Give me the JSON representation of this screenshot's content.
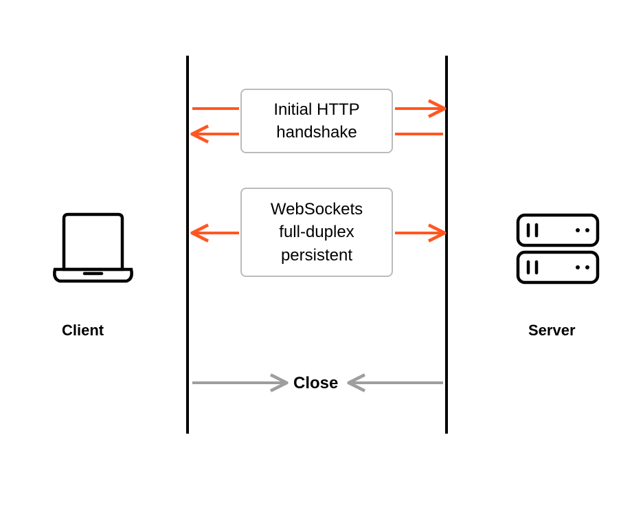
{
  "diagram_type": "sequence",
  "client": {
    "label": "Client"
  },
  "server": {
    "label": "Server"
  },
  "steps": {
    "handshake": {
      "label": "Initial HTTP\nhandshake"
    },
    "websocket": {
      "label": "WebSockets\nfull-duplex\npersistent"
    },
    "close": {
      "label": "Close"
    }
  },
  "colors": {
    "arrow_primary": "#ff5722",
    "arrow_close": "#9e9e9e",
    "lifeline": "#000000",
    "box_border": "#bbbbbb"
  }
}
